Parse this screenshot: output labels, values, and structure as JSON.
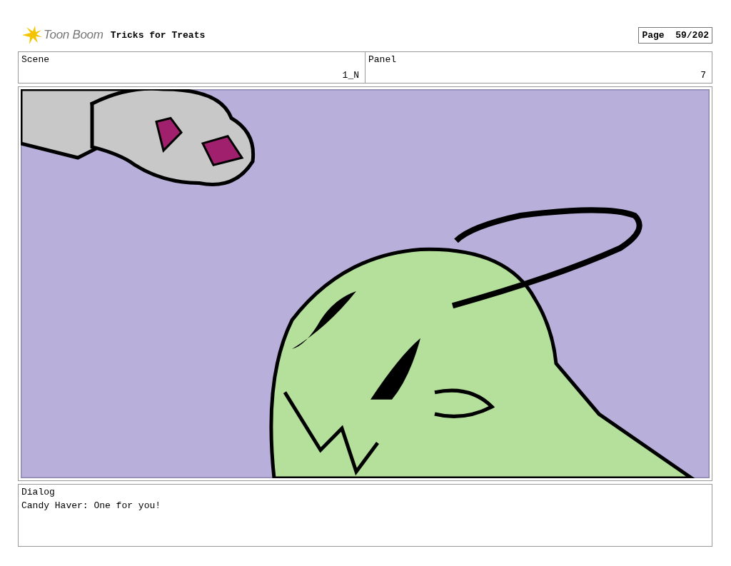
{
  "header": {
    "logo": "Toon Boom",
    "title": "Tricks for Treats",
    "page": "Page  59/202"
  },
  "info": [
    {
      "label": "Scene",
      "value": "1_N"
    },
    {
      "label": "Panel",
      "value": "7"
    }
  ],
  "dialog": {
    "label": "Dialog",
    "text": "Candy Haver: One for you!"
  }
}
